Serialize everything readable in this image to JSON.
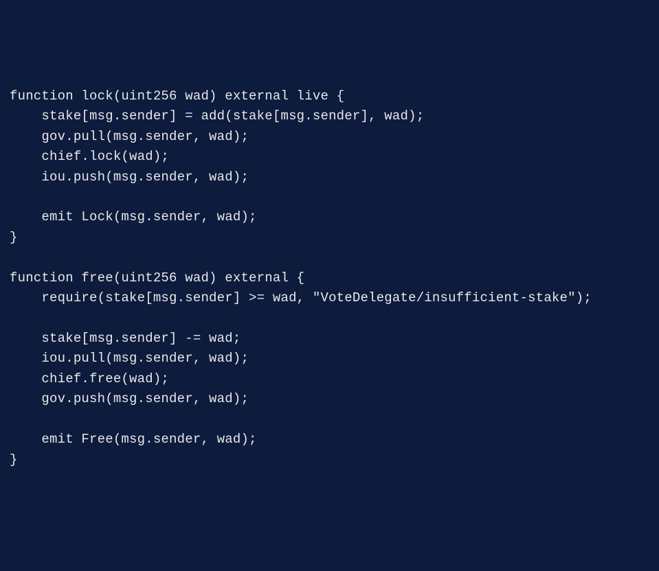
{
  "code": {
    "lines": [
      "function lock(uint256 wad) external live {",
      "    stake[msg.sender] = add(stake[msg.sender], wad);",
      "    gov.pull(msg.sender, wad);",
      "    chief.lock(wad);",
      "    iou.push(msg.sender, wad);",
      "",
      "    emit Lock(msg.sender, wad);",
      "}",
      "",
      "function free(uint256 wad) external {",
      "    require(stake[msg.sender] >= wad, \"VoteDelegate/insufficient-stake\");",
      "",
      "    stake[msg.sender] -= wad;",
      "    iou.pull(msg.sender, wad);",
      "    chief.free(wad);",
      "    gov.push(msg.sender, wad);",
      "",
      "    emit Free(msg.sender, wad);",
      "}"
    ]
  }
}
